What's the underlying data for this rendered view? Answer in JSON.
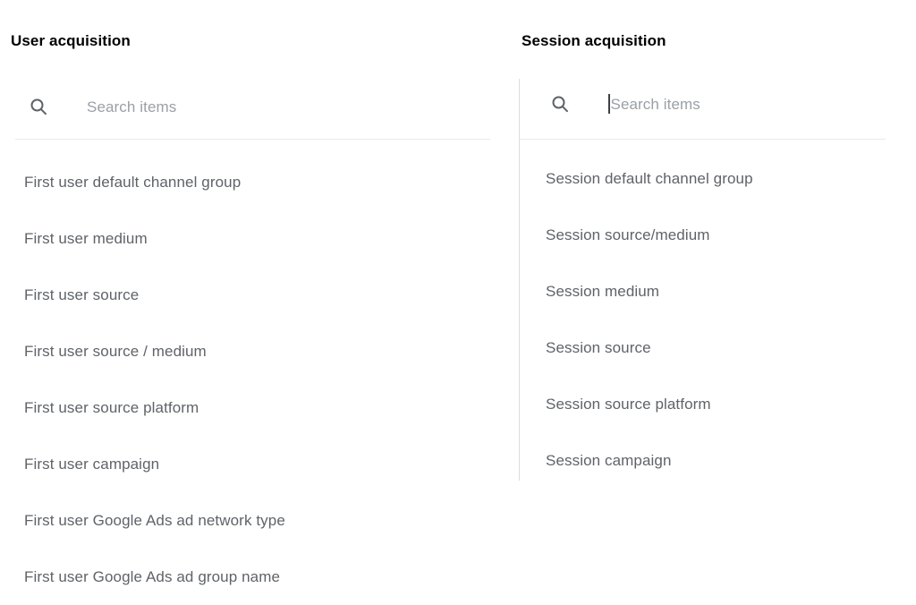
{
  "panels": [
    {
      "id": "user-acquisition",
      "title": "User acquisition",
      "search": {
        "icon": "search-icon",
        "placeholder": "Search items",
        "value": "",
        "focused": false
      },
      "items": [
        "First user default channel group",
        "First user medium",
        "First user source",
        "First user source / medium",
        "First user source platform",
        "First user campaign",
        "First user Google Ads ad network type",
        "First user Google Ads ad group name"
      ]
    },
    {
      "id": "session-acquisition",
      "title": "Session acquisition",
      "search": {
        "icon": "search-icon",
        "placeholder": "Search items",
        "value": "",
        "focused": true
      },
      "items": [
        "Session default channel group",
        "Session source/medium",
        "Session medium",
        "Session source",
        "Session source platform",
        "Session campaign"
      ]
    }
  ],
  "colors": {
    "background": "#ffffff",
    "title_text": "#000000",
    "item_text": "#5f6368",
    "placeholder_text": "#9aa0a6",
    "divider": "#dadce0",
    "underline": "#e8eaed",
    "icon": "#5f6368"
  }
}
